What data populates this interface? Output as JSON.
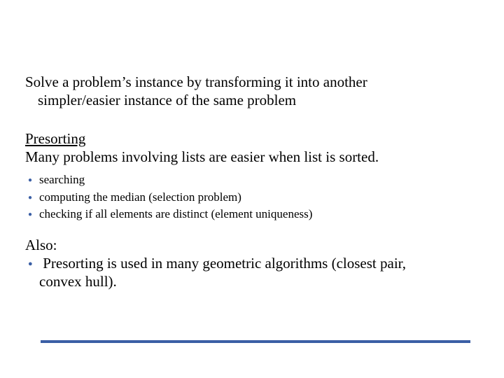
{
  "intro": {
    "line1": "Solve a problem’s instance by transforming it into another",
    "line2": "simpler/easier instance of the same problem"
  },
  "section": {
    "heading": "Presorting",
    "lead": "Many problems involving lists are easier when list is sorted."
  },
  "bullets_small": [
    "searching",
    "computing the median (selection problem)",
    "checking if all elements are distinct (element uniqueness)"
  ],
  "also_label": "Also:",
  "bullets_big": [
    {
      "line1": "Presorting is used in many geometric algorithms (closest pair,",
      "line2": "convex hull)."
    }
  ]
}
